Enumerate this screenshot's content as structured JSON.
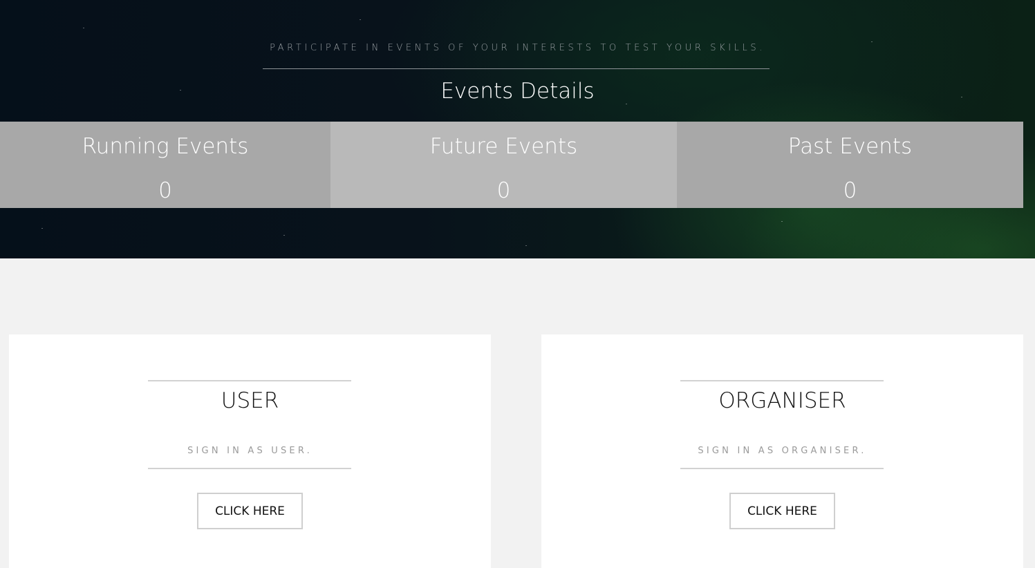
{
  "hero": {
    "tagline": "PARTICIPATE IN EVENTS OF YOUR INTERESTS TO TEST YOUR SKILLS.",
    "title": "Events Details"
  },
  "stats": [
    {
      "label": "Running Events",
      "count": "0"
    },
    {
      "label": "Future Events",
      "count": "0"
    },
    {
      "label": "Past Events",
      "count": "0"
    }
  ],
  "cards": {
    "user": {
      "title": "USER",
      "subtitle": "SIGN IN AS USER.",
      "button_label": "CLICK HERE"
    },
    "organiser": {
      "title": "ORGANISER",
      "subtitle": "SIGN IN AS ORGANISER.",
      "button_label": "CLICK HERE"
    }
  },
  "colors": {
    "hero_dark": "#08121b",
    "aurora_green": "#1e5a28",
    "stat_gray": "#a8a8a8",
    "stat_gray_light": "#b9b9b9",
    "page_bg": "#f2f2f2"
  }
}
